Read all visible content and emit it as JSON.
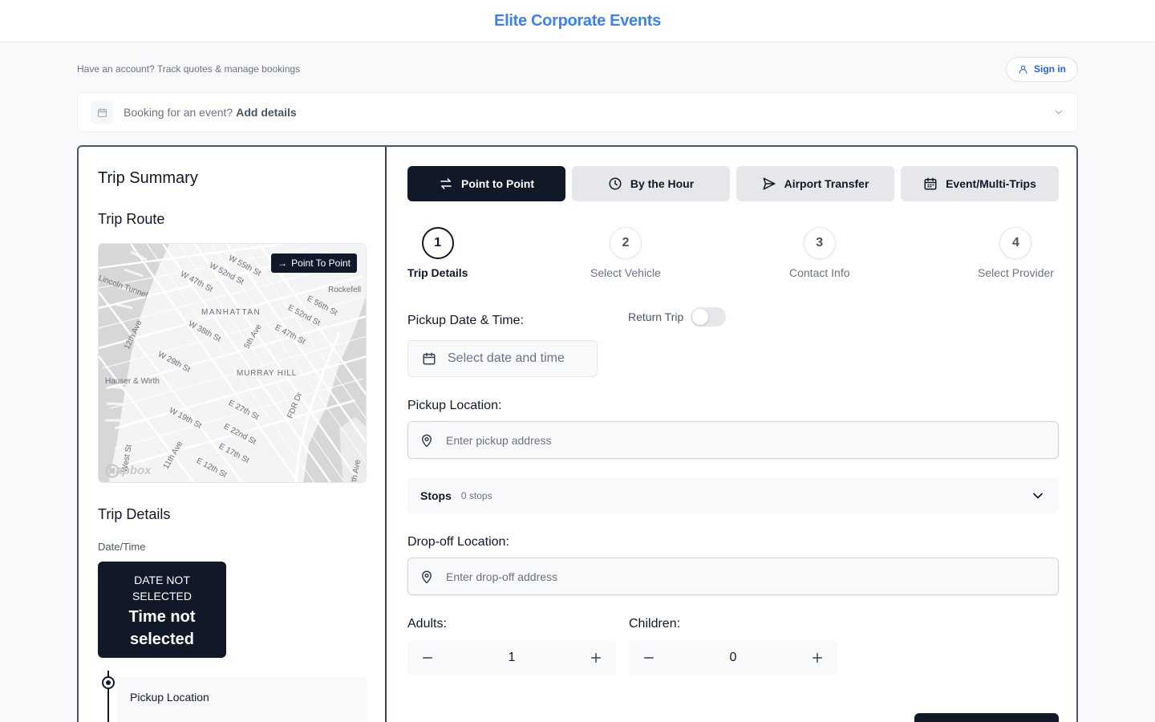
{
  "header": {
    "brand": "Elite Corporate Events"
  },
  "account": {
    "prompt": "Have an account? Track quotes & manage bookings",
    "signin_label": "Sign in"
  },
  "event_bar": {
    "prompt": "Booking for an event?",
    "action": "Add details"
  },
  "summary": {
    "title": "Trip Summary",
    "route_title": "Trip Route",
    "map": {
      "badge": "Point To Point",
      "attribution": "mapbox",
      "labels": [
        "W 55th St",
        "W 52nd St",
        "W 47th St",
        "Rockefell",
        "MANHATTAN",
        "E 56th St",
        "E 52nd St",
        "W 38th St",
        "5th Ave",
        "E 47th St",
        "12th Ave",
        "Lincoln Tunnel",
        "W 29th St",
        "MURRAY HILL",
        "Hauser & Wirth",
        "FDR Dr",
        "E 27th St",
        "W 19th St",
        "E 22nd St",
        "E 17th St",
        "11th Ave",
        "E 12th St",
        "West St",
        "8th Ave"
      ]
    },
    "details_title": "Trip Details",
    "datetime_label": "Date/Time",
    "date_value": "DATE NOT SELECTED",
    "time_value": "Time not selected",
    "pickup_label": "Pickup Location"
  },
  "modes": [
    {
      "label": "Point to Point",
      "icon": "arrows-swap-icon",
      "active": true
    },
    {
      "label": "By the Hour",
      "icon": "clock-icon",
      "active": false
    },
    {
      "label": "Airport Transfer",
      "icon": "send-icon",
      "active": false
    },
    {
      "label": "Event/Multi-Trips",
      "icon": "calendar-icon",
      "active": false
    }
  ],
  "steps": [
    {
      "num": "1",
      "label": "Trip Details",
      "active": true
    },
    {
      "num": "2",
      "label": "Select Vehicle",
      "active": false
    },
    {
      "num": "3",
      "label": "Contact Info",
      "active": false
    },
    {
      "num": "4",
      "label": "Select Provider",
      "active": false
    }
  ],
  "form": {
    "pickup_datetime_label": "Pickup Date & Time:",
    "return_trip_label": "Return Trip",
    "return_trip_on": false,
    "datetime_placeholder": "Select date and time",
    "pickup_location_label": "Pickup Location:",
    "pickup_placeholder": "Enter pickup address",
    "stops_label": "Stops",
    "stops_count": "0 stops",
    "dropoff_location_label": "Drop-off Location:",
    "dropoff_placeholder": "Enter drop-off address",
    "adults_label": "Adults:",
    "adults_value": "1",
    "children_label": "Children:",
    "children_value": "0"
  },
  "colors": {
    "brand": "#3b82f6",
    "primary": "#111827",
    "muted": "#6b7280"
  }
}
